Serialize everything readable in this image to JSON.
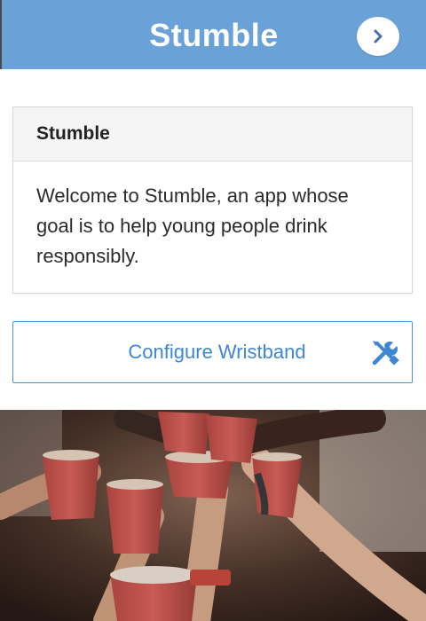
{
  "header": {
    "title": "Stumble",
    "next_icon": "chevron-right-icon",
    "color": "#6aa1d7"
  },
  "card": {
    "title": "Stumble",
    "body": "Welcome to Stumble, an app whose goal is to help young people drink responsibly."
  },
  "config_button": {
    "label": "Configure Wristband",
    "icon": "tools-icon",
    "accent": "#3f86d6"
  },
  "photo": {
    "description_icon": "party-cups-photo"
  }
}
